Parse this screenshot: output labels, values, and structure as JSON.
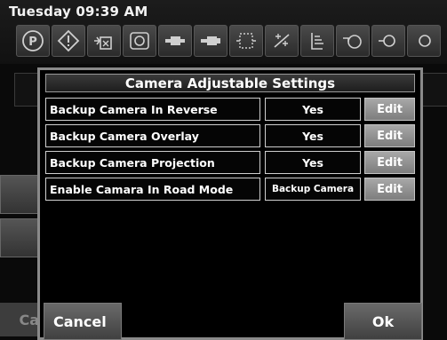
{
  "status": {
    "datetime": "Tuesday 09:39 AM"
  },
  "telltales": [
    "parking-brake-icon",
    "master-warning-icon",
    "trailer-air-icon",
    "brake-system-icon",
    "transmission-icon",
    "driveline-icon",
    "exhaust-filter-icon",
    "regen-inhibit-icon",
    "fuel-level-icon",
    "engine-oil-icon",
    "coolant-icon"
  ],
  "background": {
    "peek_text": "Ca"
  },
  "dialog": {
    "title": "Camera Adjustable Settings",
    "rows": [
      {
        "label": "Backup Camera In Reverse",
        "value": "Yes",
        "action": "Edit"
      },
      {
        "label": "Backup Camera Overlay",
        "value": "Yes",
        "action": "Edit"
      },
      {
        "label": "Backup Camera Projection",
        "value": "Yes",
        "action": "Edit"
      },
      {
        "label": "Enable Camara In Road Mode",
        "value": "Backup Camera",
        "action": "Edit"
      }
    ],
    "cancel_label": "Cancel",
    "ok_label": "Ok"
  },
  "colors": {
    "background": "#0a0a0a",
    "dialog_border": "#8a8a8a",
    "edit_button": "#959595",
    "text": "#ffffff"
  }
}
